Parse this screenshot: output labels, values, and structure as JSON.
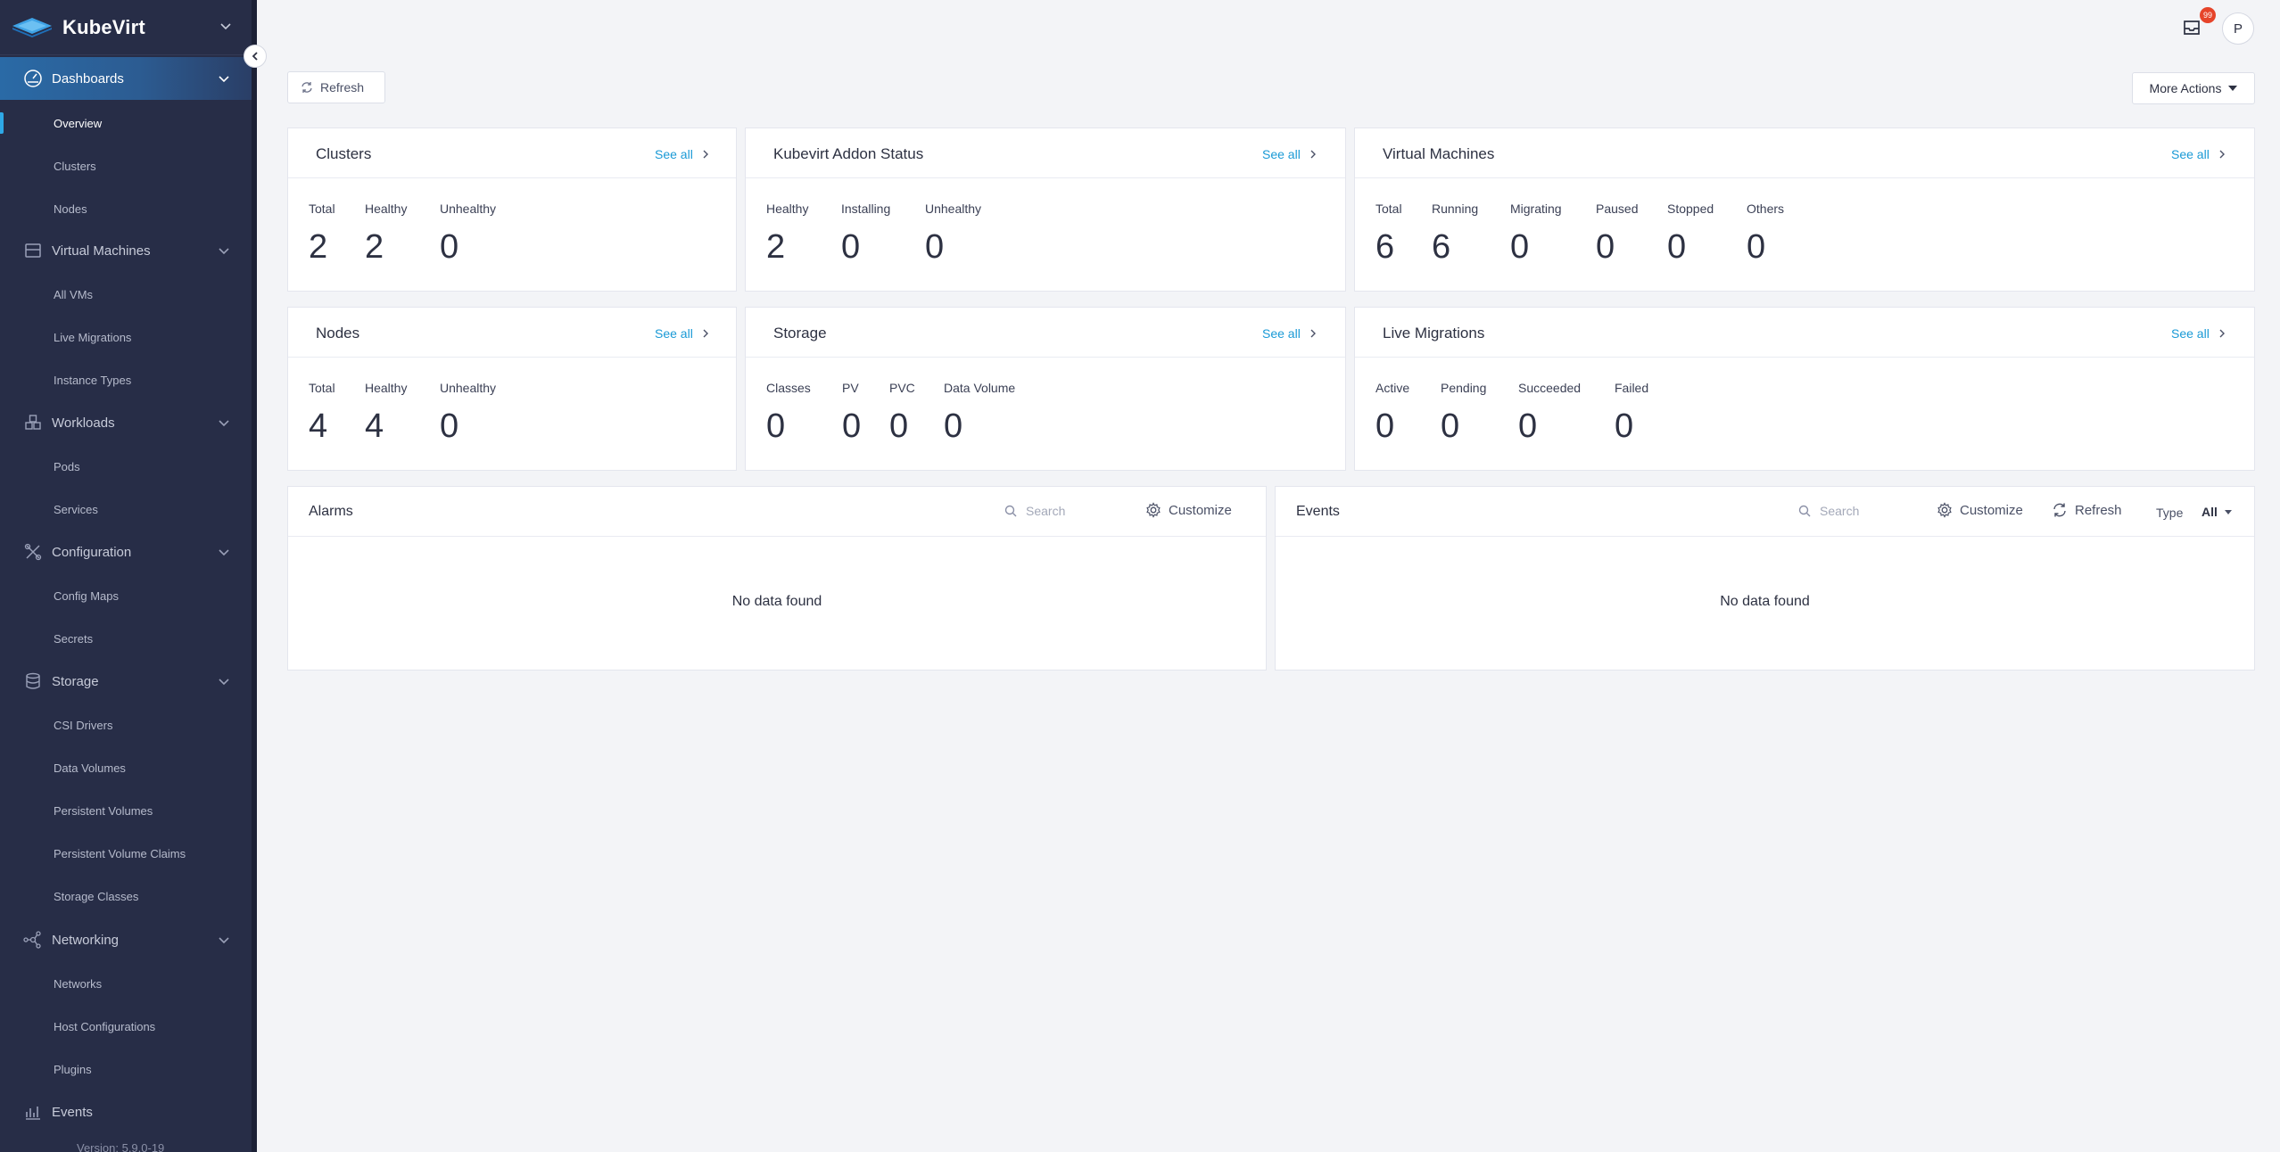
{
  "brand": {
    "name": "KubeVirt"
  },
  "sidebar": {
    "groups": [
      {
        "label": "Dashboards",
        "icon": "dashboard-icon",
        "items": [
          "Overview",
          "Clusters",
          "Nodes"
        ]
      },
      {
        "label": "Virtual Machines",
        "icon": "vm-icon",
        "items": [
          "All VMs",
          "Live Migrations",
          "Instance Types"
        ]
      },
      {
        "label": "Workloads",
        "icon": "workloads-icon",
        "items": [
          "Pods",
          "Services"
        ]
      },
      {
        "label": "Configuration",
        "icon": "configuration-icon",
        "items": [
          "Config Maps",
          "Secrets"
        ]
      },
      {
        "label": "Storage",
        "icon": "storage-icon",
        "items": [
          "CSI Drivers",
          "Data Volumes",
          "Persistent Volumes",
          "Persistent Volume Claims",
          "Storage Classes"
        ]
      },
      {
        "label": "Networking",
        "icon": "networking-icon",
        "items": [
          "Networks",
          "Host Configurations",
          "Plugins"
        ]
      },
      {
        "label": "Events",
        "icon": "events-icon",
        "items": []
      }
    ],
    "active_item": "Overview",
    "version": "Version: 5.9.0-19"
  },
  "header": {
    "notification_count": "99",
    "avatar_initial": "P"
  },
  "toolbar": {
    "refresh_label": "Refresh",
    "more_actions_label": "More Actions"
  },
  "cards": {
    "see_all": "See all",
    "clusters": {
      "title": "Clusters",
      "stats": [
        {
          "label": "Total",
          "value": "2"
        },
        {
          "label": "Healthy",
          "value": "2"
        },
        {
          "label": "Unhealthy",
          "value": "0"
        }
      ]
    },
    "addon": {
      "title": "Kubevirt Addon Status",
      "stats": [
        {
          "label": "Healthy",
          "value": "2"
        },
        {
          "label": "Installing",
          "value": "0"
        },
        {
          "label": "Unhealthy",
          "value": "0"
        }
      ]
    },
    "vms": {
      "title": "Virtual Machines",
      "stats": [
        {
          "label": "Total",
          "value": "6"
        },
        {
          "label": "Running",
          "value": "6"
        },
        {
          "label": "Migrating",
          "value": "0"
        },
        {
          "label": "Paused",
          "value": "0"
        },
        {
          "label": "Stopped",
          "value": "0"
        },
        {
          "label": "Others",
          "value": "0"
        }
      ]
    },
    "nodes": {
      "title": "Nodes",
      "stats": [
        {
          "label": "Total",
          "value": "4"
        },
        {
          "label": "Healthy",
          "value": "4"
        },
        {
          "label": "Unhealthy",
          "value": "0"
        }
      ]
    },
    "storage": {
      "title": "Storage",
      "stats": [
        {
          "label": "Classes",
          "value": "0"
        },
        {
          "label": "PV",
          "value": "0"
        },
        {
          "label": "PVC",
          "value": "0"
        },
        {
          "label": "Data Volume",
          "value": "0"
        }
      ]
    },
    "migrations": {
      "title": "Live Migrations",
      "stats": [
        {
          "label": "Active",
          "value": "0"
        },
        {
          "label": "Pending",
          "value": "0"
        },
        {
          "label": "Succeeded",
          "value": "0"
        },
        {
          "label": "Failed",
          "value": "0"
        }
      ]
    }
  },
  "alarms": {
    "title": "Alarms",
    "search_placeholder": "Search",
    "customize_label": "Customize",
    "empty_text": "No data found"
  },
  "events": {
    "title": "Events",
    "search_placeholder": "Search",
    "customize_label": "Customize",
    "refresh_label": "Refresh",
    "type_label": "Type",
    "type_value": "All",
    "empty_text": "No data found"
  }
}
